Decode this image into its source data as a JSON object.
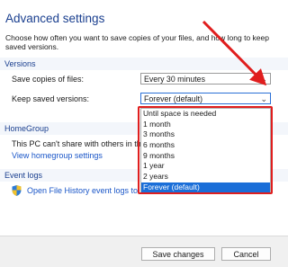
{
  "header": {
    "title": "Advanced settings",
    "description": "Choose how often you want to save copies of your files, and how long to keep saved versions."
  },
  "versions": {
    "heading": "Versions",
    "save_copies_label": "Save copies of files:",
    "save_copies_value": "Every 30 minutes",
    "keep_versions_label": "Keep saved versions:",
    "keep_versions_value": "Forever (default)",
    "options": [
      "Until space is needed",
      "1 month",
      "3 months",
      "6 months",
      "9 months",
      "1 year",
      "2 years",
      "Forever (default)"
    ],
    "selected_index": 7
  },
  "homegroup": {
    "heading": "HomeGroup",
    "text": "This PC can't share with others in the",
    "link": "View homegroup settings"
  },
  "event_logs": {
    "heading": "Event logs",
    "link": "Open File History event logs to"
  },
  "footer": {
    "save_label": "Save changes",
    "cancel_label": "Cancel"
  },
  "colors": {
    "title": "#1a3f8f",
    "link": "#1a56c8",
    "selected": "#1a6ed8",
    "annotation": "#e01e1e"
  }
}
